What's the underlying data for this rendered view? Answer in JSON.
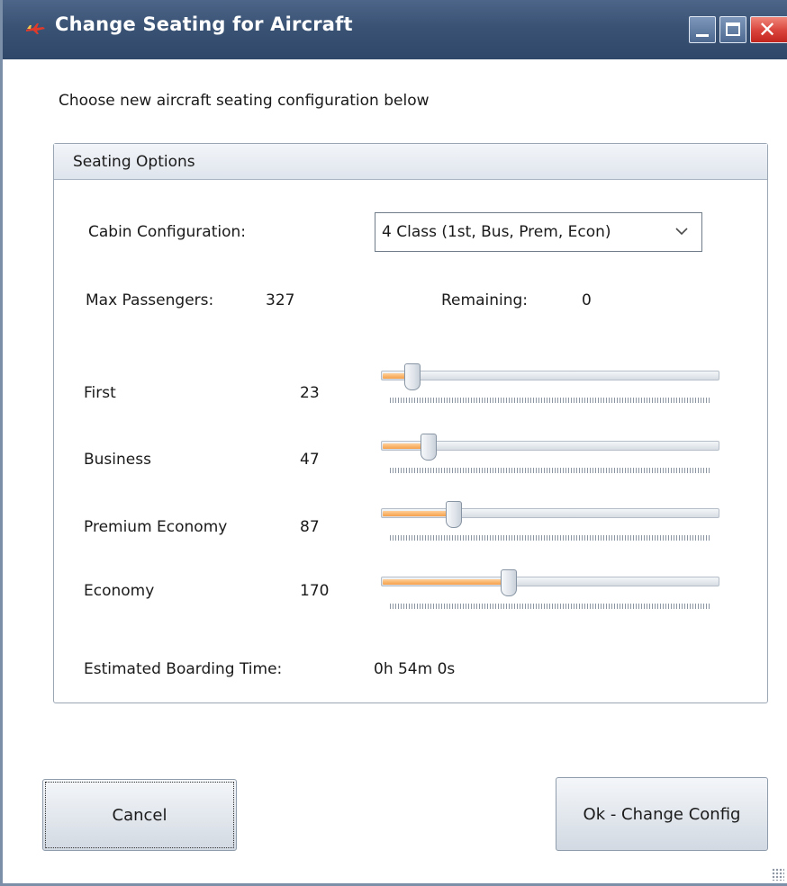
{
  "window": {
    "title": "Change Seating for Aircraft",
    "app_icon": "aircraft-icon",
    "controls": {
      "minimize": "minimize-icon",
      "maximize": "maximize-icon",
      "close": "close-icon"
    }
  },
  "intro_text": "Choose new aircraft seating configuration below",
  "seating": {
    "group_title": "Seating Options",
    "cabin_label": "Cabin Configuration:",
    "cabin_value": "4 Class (1st, Bus, Prem, Econ)",
    "max_label": "Max Passengers:",
    "max_value": "327",
    "remaining_label": "Remaining:",
    "remaining_value": "0",
    "classes": [
      {
        "label": "First",
        "value": "23",
        "slider_fraction": 0.07
      },
      {
        "label": "Business",
        "value": "47",
        "slider_fraction": 0.12
      },
      {
        "label": "Premium Economy",
        "value": "87",
        "slider_fraction": 0.2
      },
      {
        "label": "Economy",
        "value": "170",
        "slider_fraction": 0.37
      }
    ],
    "boarding_label": "Estimated Boarding Time:",
    "boarding_value": "0h 54m 0s"
  },
  "buttons": {
    "cancel": "Cancel",
    "ok": "Ok - Change Config"
  },
  "colors": {
    "titlebar": "#3a5375",
    "slider_fill": "#f5a04a",
    "close_button": "#d8423a"
  }
}
